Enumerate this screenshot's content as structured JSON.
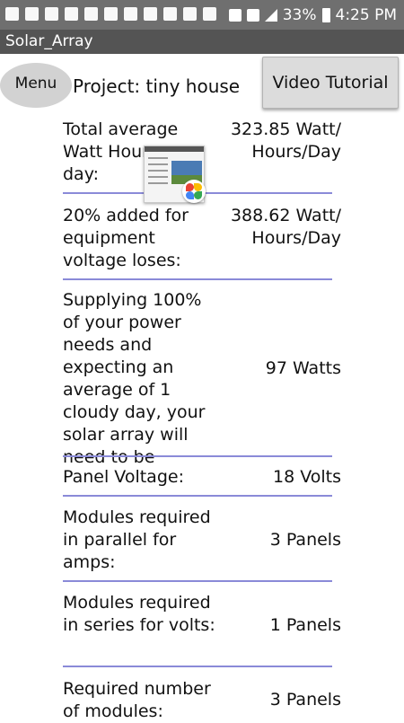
{
  "status_bar": {
    "battery": "33%",
    "time": "4:25 PM"
  },
  "app": {
    "title": "Solar_Array"
  },
  "header": {
    "menu_label": "Menu",
    "project_label": "Project: tiny house",
    "video_button_label": "Video Tutorial"
  },
  "rows": [
    {
      "label": "Total average Watt Hours per day:",
      "value": "323.85 Watt/\nHours/Day"
    },
    {
      "label": "20% added for equipment voltage loses:",
      "value": "388.62 Watt/\nHours/Day"
    },
    {
      "label": "Supplying 100% of your power needs and expecting an average of 1 cloudy day, your solar array will need to be",
      "value": "97 Watts"
    },
    {
      "label": "Panel Voltage:",
      "value": "18 Volts"
    },
    {
      "label": "Modules required in parallel for amps:",
      "value": "3 Panels"
    },
    {
      "label": "Modules required in series for volts:",
      "value": "1 Panels"
    },
    {
      "label": "Required number of modules:",
      "value": "3 Panels"
    }
  ],
  "colors": {
    "divider": "#8a8ad8",
    "titlebar": "#545454",
    "statusbar": "#6f6f6f"
  }
}
